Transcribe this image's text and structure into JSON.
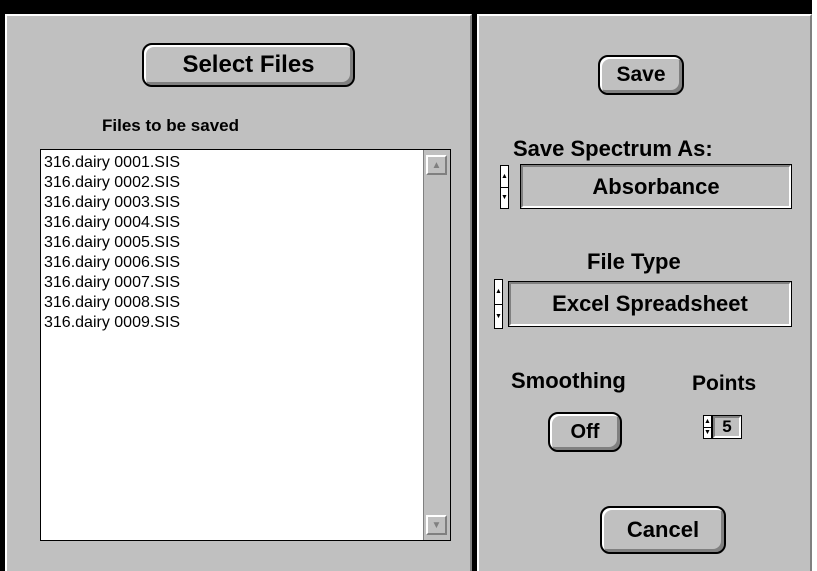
{
  "left": {
    "select_files_label": "Select Files",
    "files_heading": "Files to be saved",
    "files": [
      "316.dairy 0001.SIS",
      "316.dairy 0002.SIS",
      "316.dairy 0003.SIS",
      "316.dairy 0004.SIS",
      "316.dairy 0005.SIS",
      "316.dairy 0006.SIS",
      "316.dairy 0007.SIS",
      "316.dairy 0008.SIS",
      "316.dairy 0009.SIS"
    ]
  },
  "right": {
    "save_label": "Save",
    "save_spectrum_heading": "Save Spectrum As:",
    "save_spectrum_value": "Absorbance",
    "file_type_heading": "File Type",
    "file_type_value": "Excel Spreadsheet",
    "smoothing_heading": "Smoothing",
    "smoothing_value": "Off",
    "points_heading": "Points",
    "points_value": "5",
    "cancel_label": "Cancel"
  },
  "icons": {
    "scroll_up": "scroll-up-arrow-icon",
    "scroll_down": "scroll-down-arrow-icon",
    "spin": "spin-up-down-icon"
  },
  "colors": {
    "panel": "#c0c0c0",
    "frame": "#000000",
    "list_background": "#ffffff"
  }
}
